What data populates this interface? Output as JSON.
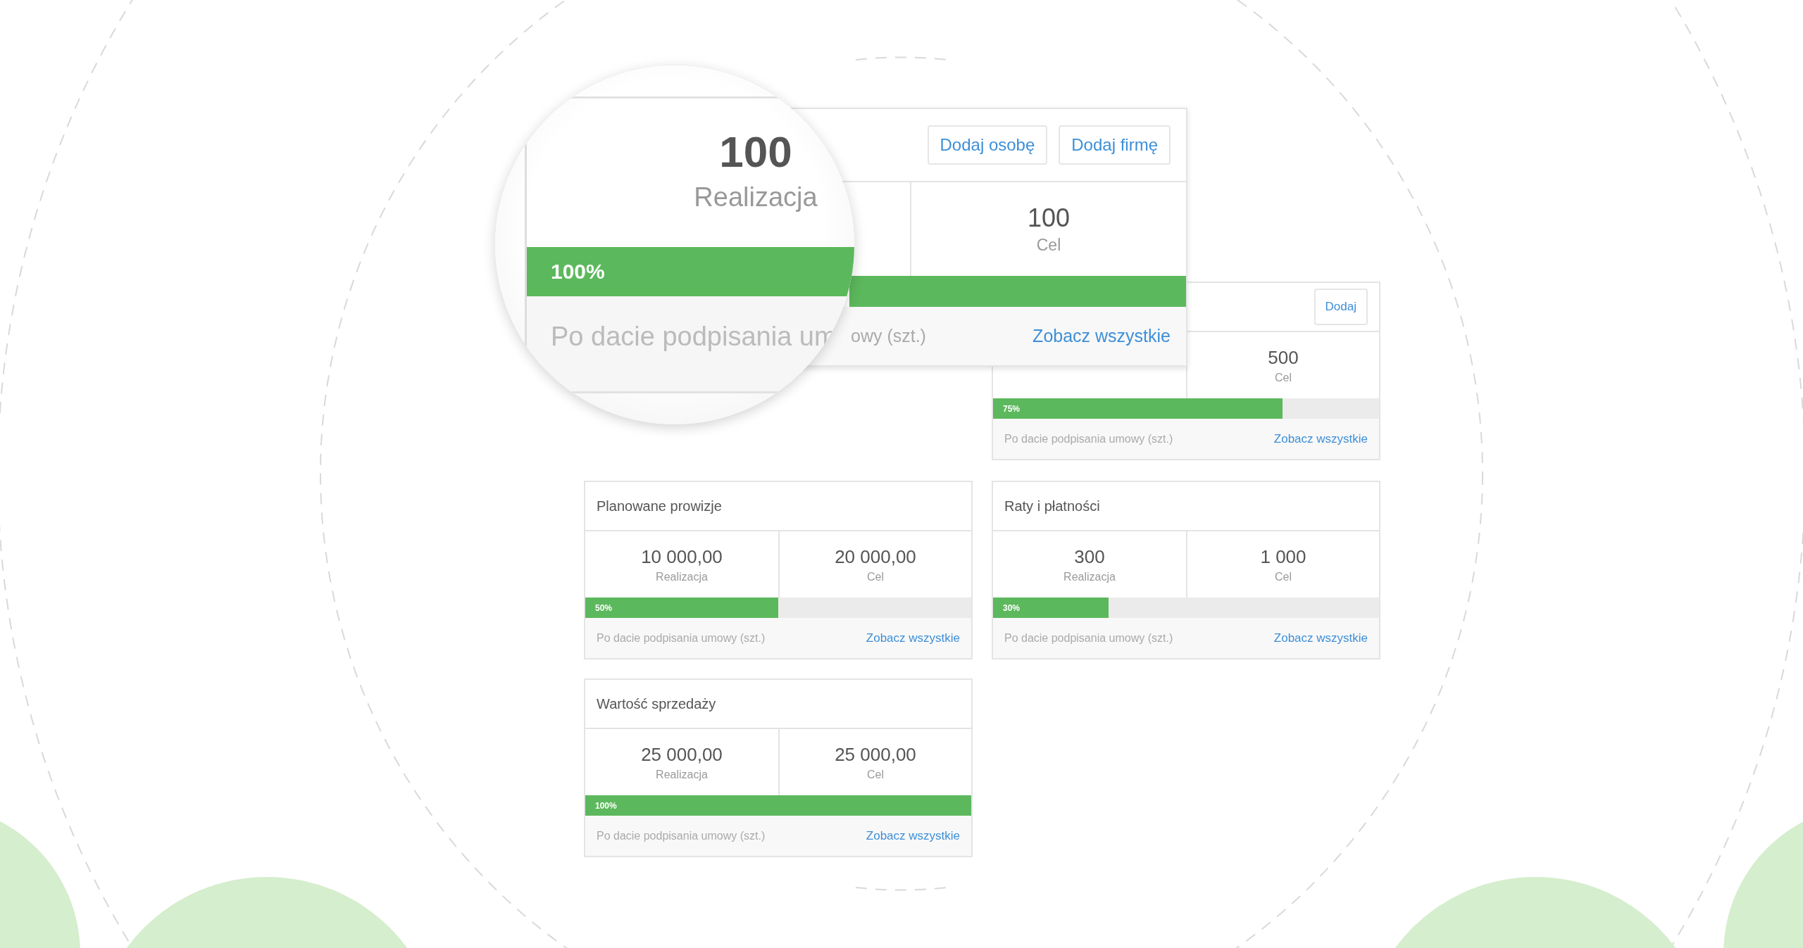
{
  "magnifier": {
    "value": "100",
    "label": "Realizacja",
    "level": 1,
    "percent": "100%",
    "footer_note": "Po dacie podpisania um"
  },
  "front_card": {
    "buttons": [
      "Dodaj osobę",
      "Dodaj firmę"
    ],
    "target": {
      "value": "100",
      "label": "Cel"
    },
    "level": 1,
    "footer_note": "owy (szt.)",
    "link": "Zobacz wszystkie"
  },
  "back_card": {
    "buttons": [
      "Dodaj"
    ],
    "target": {
      "value": "500",
      "label": "Cel"
    },
    "level": 0.75,
    "percent": "75%",
    "footer_note": "Po dacie podpisania umowy (szt.)",
    "link": "Zobacz wszystkie"
  },
  "cards": [
    {
      "title": "Planowane prowizje",
      "realization": {
        "value": "10 000,00",
        "label": "Realizacja"
      },
      "target": {
        "value": "20 000,00",
        "label": "Cel"
      },
      "level": 0.5,
      "percent": "50%",
      "footer_note": "Po dacie podpisania umowy (szt.)",
      "link": "Zobacz wszystkie"
    },
    {
      "title": "Raty i płatności",
      "realization": {
        "value": "300",
        "label": "Realizacja"
      },
      "target": {
        "value": "1 000",
        "label": "Cel"
      },
      "level": 0.3,
      "percent": "30%",
      "footer_note": "Po dacie podpisania umowy (szt.)",
      "link": "Zobacz wszystkie"
    },
    {
      "title": "Wartość sprzedaży",
      "realization": {
        "value": "25 000,00",
        "label": "Realizacja"
      },
      "target": {
        "value": "25 000,00",
        "label": "Cel"
      },
      "level": 1,
      "percent": "100%",
      "footer_note": "Po dacie podpisania umowy (szt.)",
      "link": "Zobacz wszystkie"
    }
  ]
}
